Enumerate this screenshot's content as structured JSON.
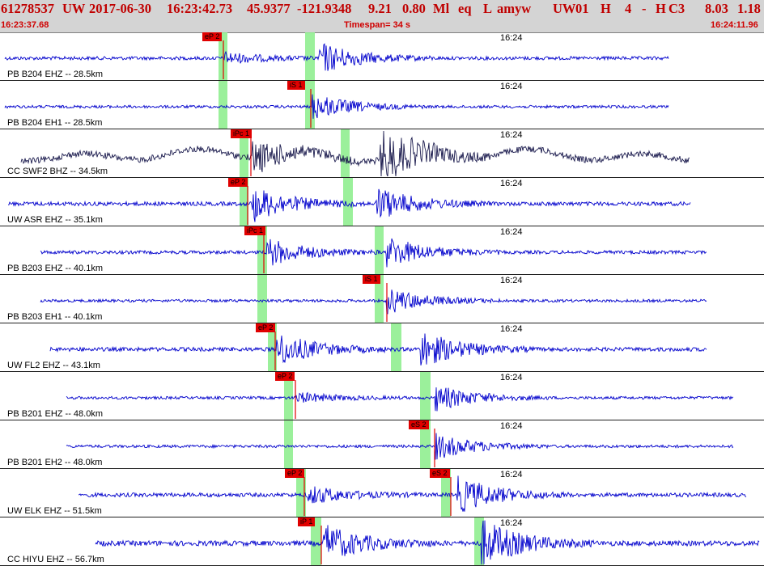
{
  "header": {
    "event_fields": [
      "61278537",
      "UW",
      "2017-06-30",
      "16:23:42.73",
      "45.9377",
      "-121.9348",
      "9.21",
      "0.80",
      "Ml",
      "eq",
      "L",
      "amyw",
      "UW",
      "01",
      "H",
      "4",
      "-",
      "H",
      "C3",
      "8.03",
      "1.18"
    ],
    "start_time": "16:23:37.68",
    "timespan": "Timespan=  34 s",
    "end_time": "16:24:11.96"
  },
  "colors": {
    "trace": "#0000cc",
    "trace_alt": "#1a1a4d",
    "pick": "#e00000",
    "window": "#90ee90",
    "header_bg": "#d4d4d4",
    "header_text": "#c00000"
  },
  "panels": [
    {
      "label": "PB B204 EHZ -- 28.5km",
      "minute": "16:24",
      "picks": [
        {
          "label": "eP 2"
        }
      ],
      "trace_color": "blue",
      "amplitude": "moderate"
    },
    {
      "label": "PB B204 EH1 -- 28.5km",
      "minute": "16:24",
      "picks": [
        {
          "label": "iS 1"
        }
      ],
      "trace_color": "blue",
      "amplitude": "moderate"
    },
    {
      "label": "CC SWF2 BHZ -- 34.5km",
      "minute": "16:24",
      "picks": [
        {
          "label": "iPc 1"
        }
      ],
      "trace_color": "dark",
      "amplitude": "large"
    },
    {
      "label": "UW ASR EHZ -- 35.1km",
      "minute": "16:24",
      "picks": [
        {
          "label": "eP 2"
        }
      ],
      "trace_color": "blue",
      "amplitude": "large"
    },
    {
      "label": "PB B203 EHZ -- 40.1km",
      "minute": "16:24",
      "picks": [
        {
          "label": "iPc 1"
        }
      ],
      "trace_color": "blue",
      "amplitude": "large"
    },
    {
      "label": "PB B203 EH1 -- 40.1km",
      "minute": "16:24",
      "picks": [
        {
          "label": "iS 1"
        }
      ],
      "trace_color": "blue",
      "amplitude": "moderate"
    },
    {
      "label": "UW FL2 EHZ -- 43.1km",
      "minute": "16:24",
      "picks": [
        {
          "label": "eP 2"
        }
      ],
      "trace_color": "blue",
      "amplitude": "large"
    },
    {
      "label": "PB B201 EHZ -- 48.0km",
      "minute": "16:24",
      "picks": [
        {
          "label": "eP 2"
        }
      ],
      "trace_color": "blue",
      "amplitude": "moderate"
    },
    {
      "label": "PB B201 EH2 -- 48.0km",
      "minute": "16:24",
      "picks": [
        {
          "label": "eS 2"
        }
      ],
      "trace_color": "blue",
      "amplitude": "moderate"
    },
    {
      "label": "UW ELK EHZ -- 51.5km",
      "minute": "16:24",
      "picks": [
        {
          "label": "eP 2"
        },
        {
          "label": "eS 2"
        }
      ],
      "trace_color": "blue",
      "amplitude": "large"
    },
    {
      "label": "CC HIYU EHZ -- 56.7km",
      "minute": "16:24",
      "picks": [
        {
          "label": "iP 1"
        }
      ],
      "trace_color": "blue",
      "amplitude": "large"
    }
  ]
}
